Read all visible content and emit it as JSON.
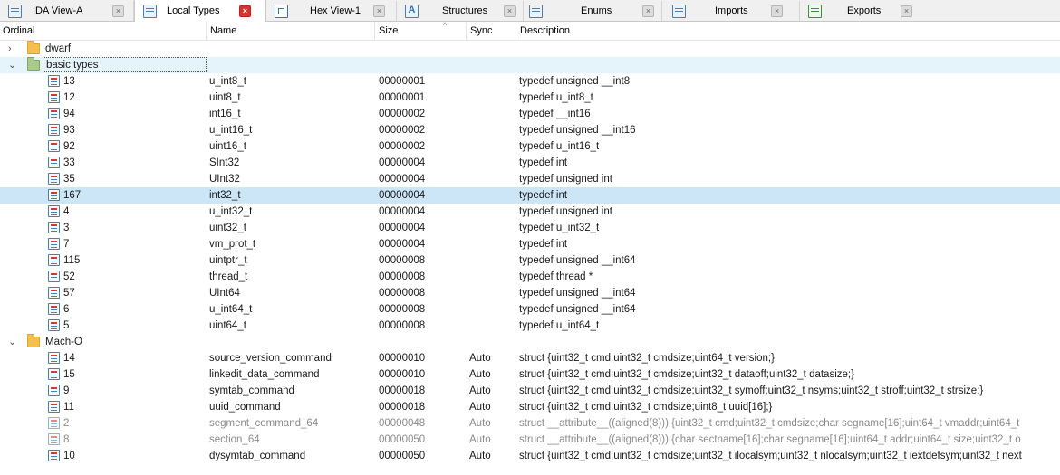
{
  "tabs": [
    {
      "label": "IDA View-A",
      "icon": "disassembly-icon",
      "active": false
    },
    {
      "label": "Local Types",
      "icon": "local-types-icon",
      "active": true
    },
    {
      "label": "Hex View-1",
      "icon": "hex-view-icon",
      "active": false
    },
    {
      "label": "Structures",
      "icon": "structures-icon",
      "active": false
    },
    {
      "label": "Enums",
      "icon": "enums-icon",
      "active": false
    },
    {
      "label": "Imports",
      "icon": "imports-icon",
      "active": false
    },
    {
      "label": "Exports",
      "icon": "exports-icon",
      "active": false
    }
  ],
  "tab_close_glyph": "×",
  "columns": {
    "ordinal": "Ordinal",
    "name": "Name",
    "size": "Size",
    "sync": "Sync",
    "description": "Description",
    "sort_indicator": "^"
  },
  "chevrons": {
    "collapsed": "›",
    "expanded": "⌄"
  },
  "groups": [
    {
      "label": "dwarf",
      "expanded": false
    },
    {
      "label": "basic types",
      "expanded": true
    },
    {
      "label": "Mach-O",
      "expanded": true
    }
  ],
  "basic_types_rows": [
    {
      "ordinal": "13",
      "name": "u_int8_t",
      "size": "00000001",
      "sync": "",
      "description": "typedef unsigned __int8"
    },
    {
      "ordinal": "12",
      "name": "uint8_t",
      "size": "00000001",
      "sync": "",
      "description": "typedef u_int8_t"
    },
    {
      "ordinal": "94",
      "name": "int16_t",
      "size": "00000002",
      "sync": "",
      "description": "typedef __int16"
    },
    {
      "ordinal": "93",
      "name": "u_int16_t",
      "size": "00000002",
      "sync": "",
      "description": "typedef unsigned __int16"
    },
    {
      "ordinal": "92",
      "name": "uint16_t",
      "size": "00000002",
      "sync": "",
      "description": "typedef u_int16_t"
    },
    {
      "ordinal": "33",
      "name": "SInt32",
      "size": "00000004",
      "sync": "",
      "description": "typedef int"
    },
    {
      "ordinal": "35",
      "name": "UInt32",
      "size": "00000004",
      "sync": "",
      "description": "typedef unsigned int"
    },
    {
      "ordinal": "167",
      "name": "int32_t",
      "size": "00000004",
      "sync": "",
      "description": "typedef int"
    },
    {
      "ordinal": "4",
      "name": "u_int32_t",
      "size": "00000004",
      "sync": "",
      "description": "typedef unsigned int"
    },
    {
      "ordinal": "3",
      "name": "uint32_t",
      "size": "00000004",
      "sync": "",
      "description": "typedef u_int32_t"
    },
    {
      "ordinal": "7",
      "name": "vm_prot_t",
      "size": "00000004",
      "sync": "",
      "description": "typedef int"
    },
    {
      "ordinal": "115",
      "name": "uintptr_t",
      "size": "00000008",
      "sync": "",
      "description": "typedef unsigned __int64"
    },
    {
      "ordinal": "52",
      "name": "thread_t",
      "size": "00000008",
      "sync": "",
      "description": "typedef thread *"
    },
    {
      "ordinal": "57",
      "name": "UInt64",
      "size": "00000008",
      "sync": "",
      "description": "typedef unsigned __int64"
    },
    {
      "ordinal": "6",
      "name": "u_int64_t",
      "size": "00000008",
      "sync": "",
      "description": "typedef unsigned __int64"
    },
    {
      "ordinal": "5",
      "name": "uint64_t",
      "size": "00000008",
      "sync": "",
      "description": "typedef u_int64_t"
    }
  ],
  "macho_rows": [
    {
      "ordinal": "14",
      "name": "source_version_command",
      "size": "00000010",
      "sync": "Auto",
      "description": "struct {uint32_t cmd;uint32_t cmdsize;uint64_t version;}",
      "dim": false
    },
    {
      "ordinal": "15",
      "name": "linkedit_data_command",
      "size": "00000010",
      "sync": "Auto",
      "description": "struct {uint32_t cmd;uint32_t cmdsize;uint32_t dataoff;uint32_t datasize;}",
      "dim": false
    },
    {
      "ordinal": "9",
      "name": "symtab_command",
      "size": "00000018",
      "sync": "Auto",
      "description": "struct {uint32_t cmd;uint32_t cmdsize;uint32_t symoff;uint32_t nsyms;uint32_t stroff;uint32_t strsize;}",
      "dim": false
    },
    {
      "ordinal": "11",
      "name": "uuid_command",
      "size": "00000018",
      "sync": "Auto",
      "description": "struct {uint32_t cmd;uint32_t cmdsize;uint8_t uuid[16];}",
      "dim": false
    },
    {
      "ordinal": "2",
      "name": "segment_command_64",
      "size": "00000048",
      "sync": "Auto",
      "description": "struct __attribute__((aligned(8))) {uint32_t cmd;uint32_t cmdsize;char segname[16];uint64_t vmaddr;uint64_t",
      "dim": true
    },
    {
      "ordinal": "8",
      "name": "section_64",
      "size": "00000050",
      "sync": "Auto",
      "description": "struct __attribute__((aligned(8))) {char sectname[16];char segname[16];uint64_t addr;uint64_t size;uint32_t o",
      "dim": true
    },
    {
      "ordinal": "10",
      "name": "dysymtab_command",
      "size": "00000050",
      "sync": "Auto",
      "description": "struct {uint32_t cmd;uint32_t cmdsize;uint32_t ilocalsym;uint32_t nlocalsym;uint32_t iextdefsym;uint32_t next",
      "dim": false
    }
  ]
}
